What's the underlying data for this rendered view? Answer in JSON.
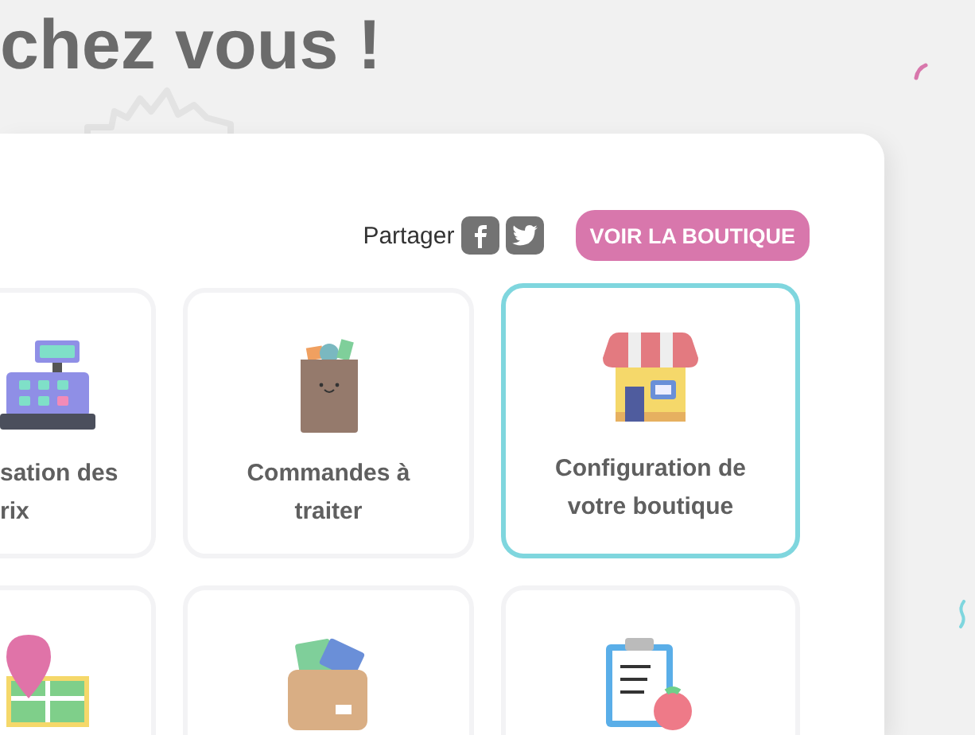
{
  "heading": "chez vous !",
  "share": {
    "label": "Partager"
  },
  "shop_button": "VOIR LA BOUTIQUE",
  "tiles": [
    {
      "kind": "register",
      "lines": [
        "sation des",
        "rix"
      ],
      "selected": false
    },
    {
      "kind": "bag",
      "lines": [
        "Commandes à",
        "traiter"
      ],
      "selected": false
    },
    {
      "kind": "shop",
      "lines": [
        "Configuration de",
        "votre boutique"
      ],
      "selected": true
    },
    {
      "kind": "map",
      "selected": false
    },
    {
      "kind": "wallet",
      "selected": false
    },
    {
      "kind": "clipboard",
      "selected": false
    }
  ]
}
